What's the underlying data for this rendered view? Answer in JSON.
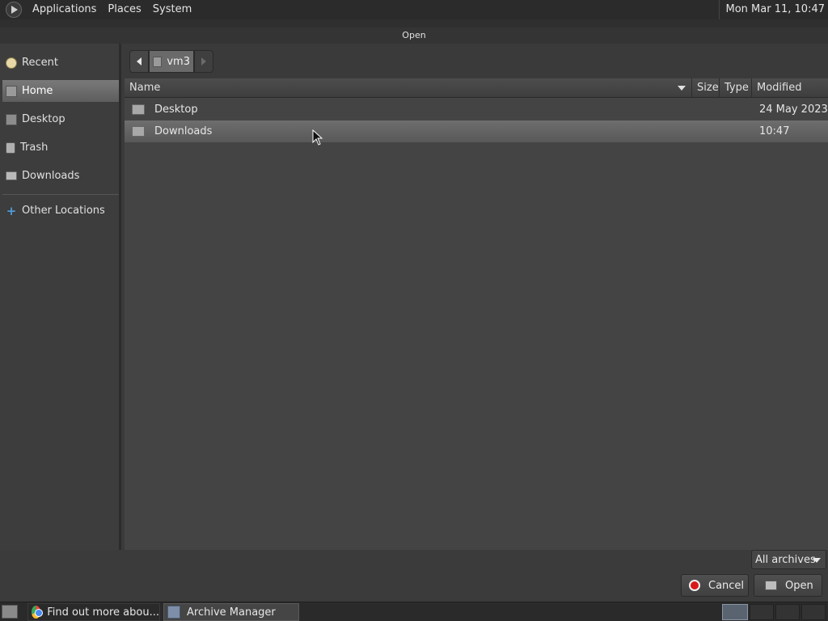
{
  "top_panel": {
    "menus": [
      "Applications",
      "Places",
      "System"
    ],
    "clock": "Mon Mar 11, 10:47"
  },
  "dialog": {
    "title": "Open"
  },
  "sidebar": {
    "items": [
      {
        "label": "Recent",
        "icon": "recent-icon"
      },
      {
        "label": "Home",
        "icon": "home-icon"
      },
      {
        "label": "Desktop",
        "icon": "desktop-icon"
      },
      {
        "label": "Trash",
        "icon": "trash-icon"
      },
      {
        "label": "Downloads",
        "icon": "folder-icon"
      },
      {
        "label": "Other Locations",
        "icon": "plus-icon"
      }
    ],
    "selected": "Home"
  },
  "pathbar": {
    "current": "vm3"
  },
  "file_list": {
    "columns": [
      "Name",
      "Size",
      "Type",
      "Modified"
    ],
    "rows": [
      {
        "name": "Desktop",
        "size": "",
        "type": "",
        "modified": "24 May 2023"
      },
      {
        "name": "Downloads",
        "size": "",
        "type": "",
        "modified": "10:47"
      }
    ],
    "selected_row": "Downloads"
  },
  "filter": {
    "selected": "All archives"
  },
  "buttons": {
    "cancel": "Cancel",
    "open": "Open"
  },
  "taskbar": {
    "tasks": [
      {
        "label": "Find out more abou...",
        "icon": "chrome-icon"
      },
      {
        "label": "Archive Manager",
        "icon": "archive-manager-icon"
      }
    ]
  }
}
